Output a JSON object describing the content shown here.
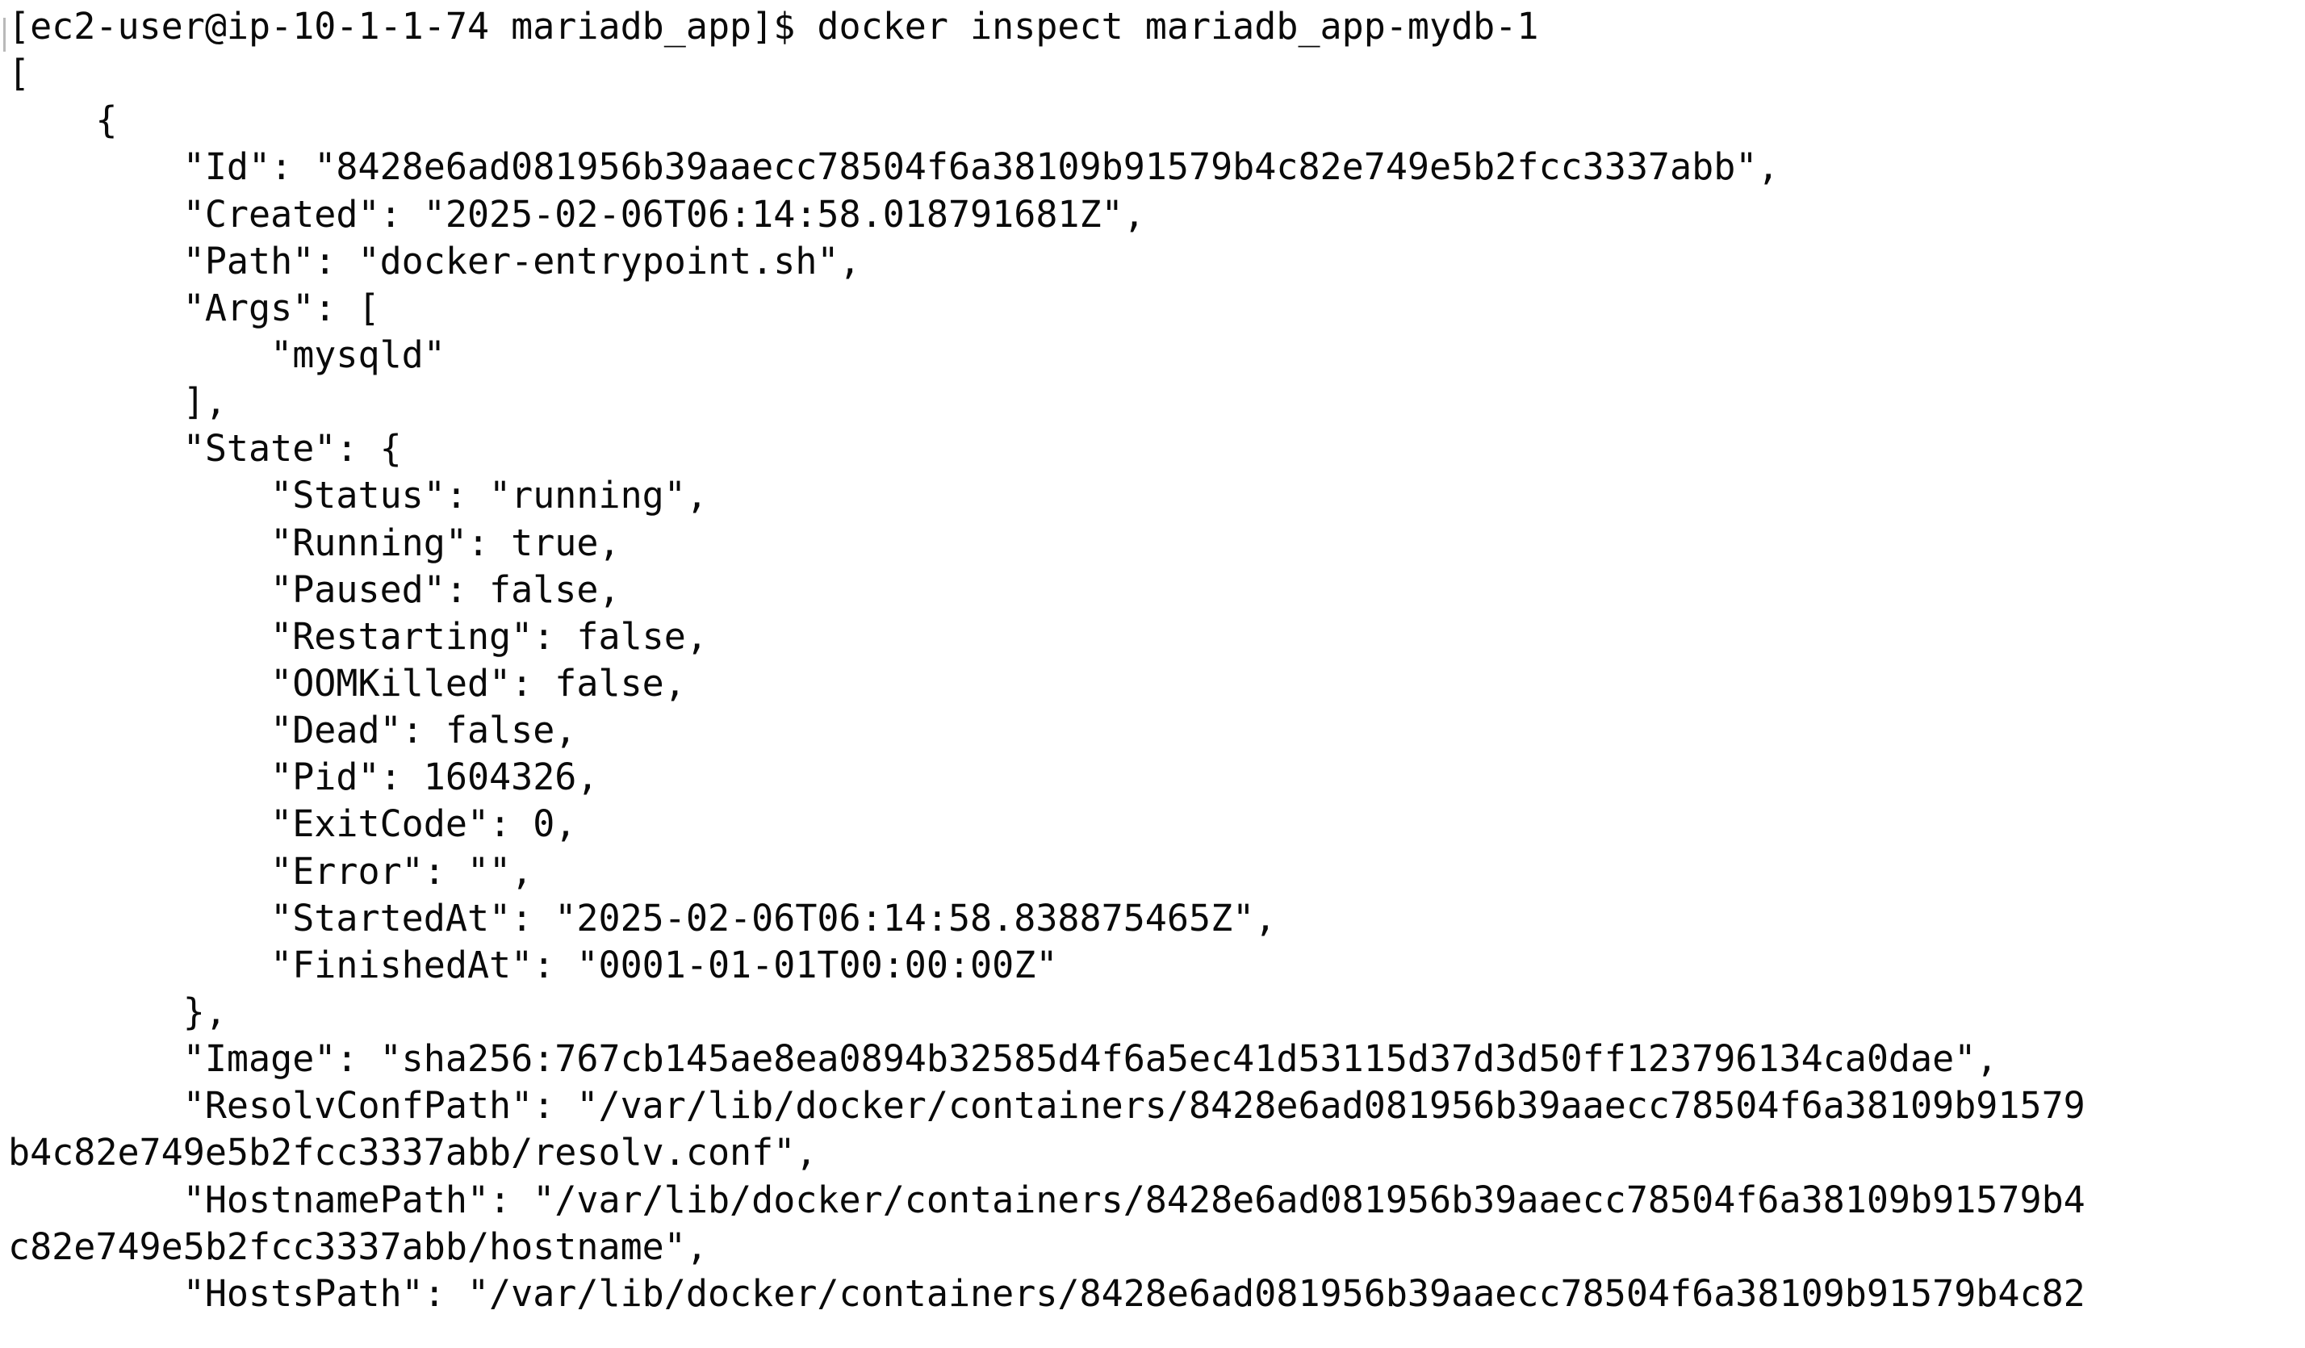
{
  "terminal": {
    "lines": [
      "[ec2-user@ip-10-1-1-74 mariadb_app]$ docker inspect mariadb_app-mydb-1",
      "[",
      "    {",
      "        \"Id\": \"8428e6ad081956b39aaecc78504f6a38109b91579b4c82e749e5b2fcc3337abb\",",
      "        \"Created\": \"2025-02-06T06:14:58.018791681Z\",",
      "        \"Path\": \"docker-entrypoint.sh\",",
      "        \"Args\": [",
      "            \"mysqld\"",
      "        ],",
      "        \"State\": {",
      "            \"Status\": \"running\",",
      "            \"Running\": true,",
      "            \"Paused\": false,",
      "            \"Restarting\": false,",
      "            \"OOMKilled\": false,",
      "            \"Dead\": false,",
      "            \"Pid\": 1604326,",
      "            \"ExitCode\": 0,",
      "            \"Error\": \"\",",
      "            \"StartedAt\": \"2025-02-06T06:14:58.838875465Z\",",
      "            \"FinishedAt\": \"0001-01-01T00:00:00Z\"",
      "        },",
      "        \"Image\": \"sha256:767cb145ae8ea0894b32585d4f6a5ec41d53115d37d3d50ff123796134ca0dae\",",
      "        \"ResolvConfPath\": \"/var/lib/docker/containers/8428e6ad081956b39aaecc78504f6a38109b91579",
      "b4c82e749e5b2fcc3337abb/resolv.conf\",",
      "        \"HostnamePath\": \"/var/lib/docker/containers/8428e6ad081956b39aaecc78504f6a38109b91579b4",
      "c82e749e5b2fcc3337abb/hostname\",",
      "        \"HostsPath\": \"/var/lib/docker/containers/8428e6ad081956b39aaecc78504f6a38109b91579b4c82"
    ]
  }
}
